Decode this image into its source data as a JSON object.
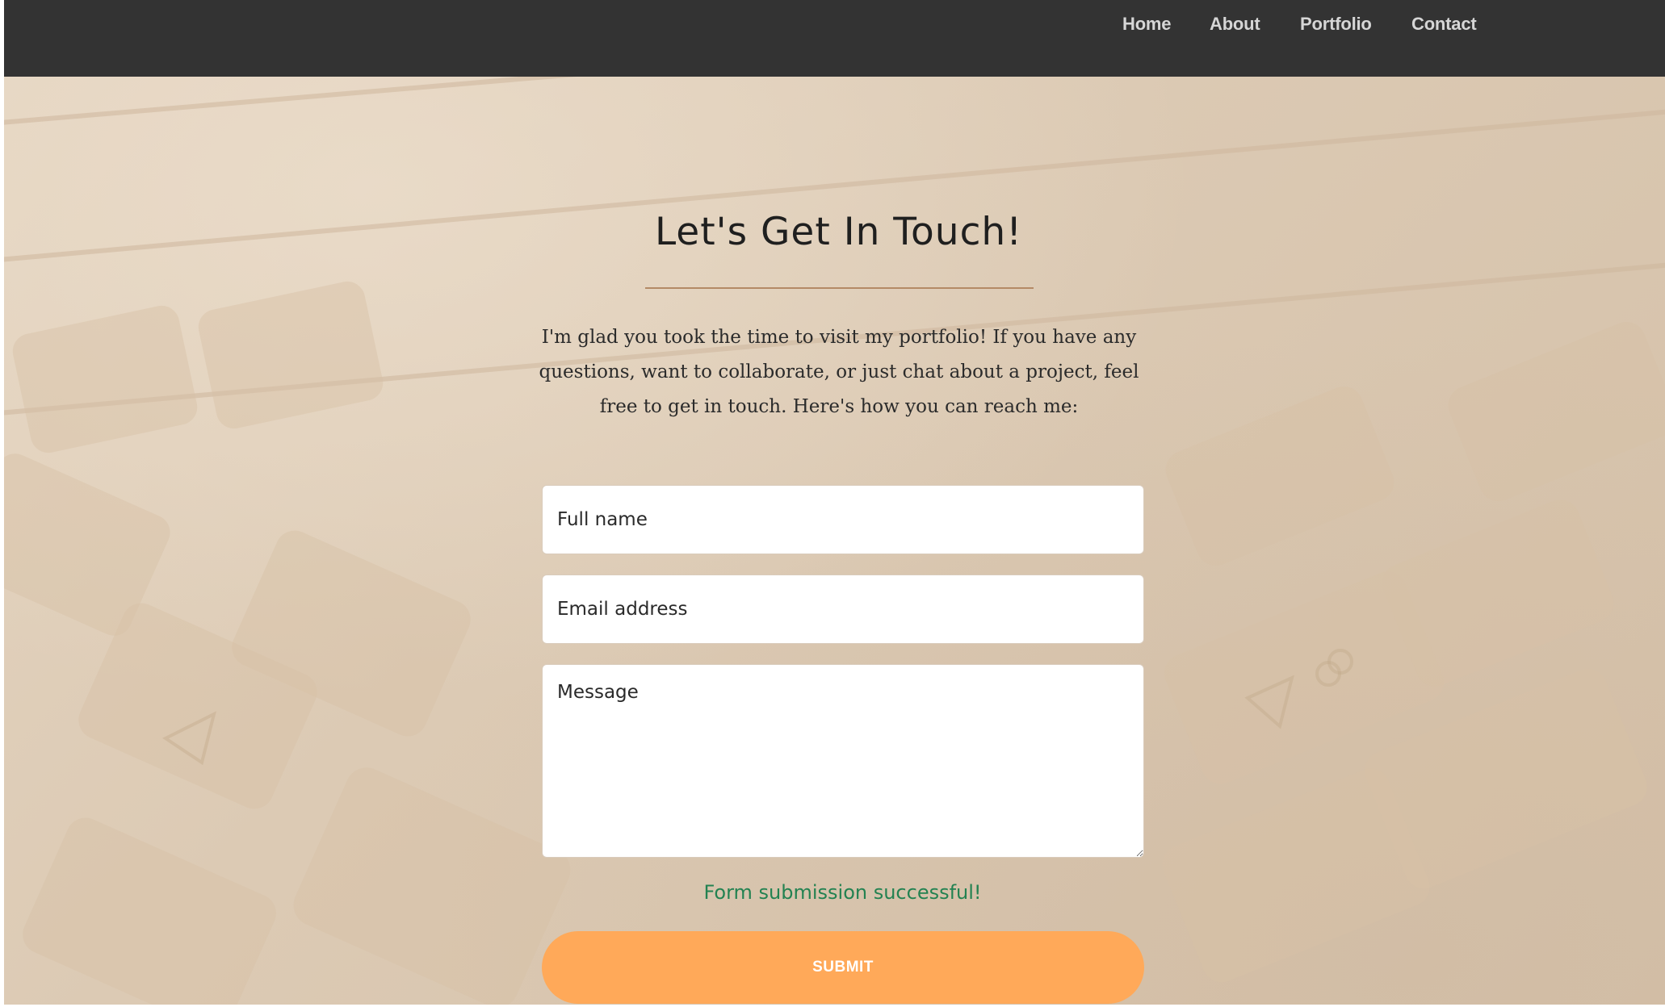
{
  "nav": {
    "items": [
      {
        "label": "Home"
      },
      {
        "label": "About"
      },
      {
        "label": "Portfolio"
      },
      {
        "label": "Contact"
      }
    ]
  },
  "contact": {
    "title": "Let's Get In Touch!",
    "intro": "I'm glad you took the time to visit my portfolio! If you have any questions, want to collaborate, or just chat about a project, feel free to get in touch. Here's how you can reach me:",
    "form": {
      "name_placeholder": "Full name",
      "name_value": "",
      "email_placeholder": "Email address",
      "email_value": "",
      "message_placeholder": "Message",
      "message_value": "",
      "status_message": "Form submission successful!",
      "submit_label": "SUBMIT"
    }
  },
  "colors": {
    "nav_background": "#333333",
    "nav_text": "#d6d6d6",
    "accent_button": "#ffa959",
    "success_text": "#238251",
    "title_rule": "#b48a66"
  },
  "background": {
    "image_subject": "faded laptop keyboard photo"
  }
}
